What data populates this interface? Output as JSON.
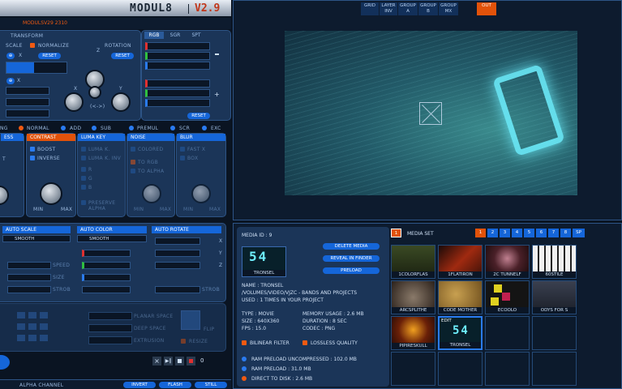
{
  "app": {
    "brand": "MODUL8",
    "version": "V2.9",
    "subtitle": "MODULSV29 2310"
  },
  "transform": {
    "title": "TRANSFORM",
    "scale_label": "SCALE",
    "normalize_label": "NORMALIZE",
    "rotation_label": "ROTATION",
    "x_label": "X",
    "y_label": "Y",
    "z_label": "Z",
    "reset_label": "RESET",
    "dir_label": "(<->)"
  },
  "color_tabs": [
    "RGB",
    "SGR",
    "SPT"
  ],
  "color_reset": "RESET",
  "blend_modes": [
    "NG",
    "NORMAL",
    "ADD",
    "SUB"
  ],
  "blend_modes2": [
    "PREMUL",
    "SCR",
    "EXC"
  ],
  "fx": {
    "col1": {
      "title": "ESS",
      "items": [
        "T"
      ]
    },
    "contrast": {
      "title": "CONTRAST",
      "items": [
        "BOOST",
        "INVERSE"
      ]
    },
    "lumakey": {
      "title": "LUMA KEY",
      "items": [
        "LUMA K.",
        "LUMA K. INV",
        "R",
        "G",
        "B",
        "PRESERVE ALPHA"
      ]
    },
    "noise": {
      "title": "NOISE",
      "items": [
        "COLORED",
        "TO RGB",
        "TO ALPHA"
      ]
    },
    "blur": {
      "title": "BLUR",
      "items": [
        "FAST X",
        "BOX"
      ]
    },
    "min_label": "MIN",
    "max_label": "MAX"
  },
  "auto": {
    "scale": {
      "title": "AUTO SCALE",
      "mode": "SMOOTH"
    },
    "color": {
      "title": "AUTO COLOR",
      "mode": "SMOOTH"
    },
    "rotate": {
      "title": "AUTO ROTATE"
    },
    "speed_label": "SPEED",
    "size_label": "SIZE",
    "strob_label": "STROB",
    "xyz": [
      "X",
      "Y",
      "Z"
    ]
  },
  "planar": {
    "space1": "PLANAR SPACE",
    "space2": "DEEP SPACE",
    "extrusion": "EXTRUSION",
    "flip": "FLIP",
    "resize": "RESIZE",
    "counter": "0"
  },
  "bottom_bar": {
    "alpha_label": "ALPHA CHANNEL",
    "invert": "INVERT",
    "flash": "FLASH",
    "still": "STILL"
  },
  "preview_tabs": [
    {
      "label": "GRID",
      "active": false
    },
    {
      "label": "LAYER INV",
      "active": false
    },
    {
      "label": "GROUP A",
      "active": false
    },
    {
      "label": "GROUP B",
      "active": false
    },
    {
      "label": "GROUP MX",
      "active": false
    },
    {
      "label": "OUT",
      "active": true
    }
  ],
  "media": {
    "media_id": "MEDIA ID : 9",
    "preview_name": "TRONSEL",
    "delete": "DELETE MEDIA",
    "reveal": "REVEAL IN FINDER",
    "preload": "PRELOAD",
    "name": "NAME : TRONSEL",
    "path": "/VOLUMES/VIDEO/VJZC - BANDS AND PROJECTS",
    "used": "USED : 1 TIMES IN YOUR PROJECT",
    "type": "TYPE : MOVIE",
    "size": "SIZE : 640X360",
    "fps": "FPS : 15.0",
    "memory": "MEMORY USAGE : 2.6 MB",
    "duration": "DURATION : 8 SEC",
    "codec": "CODEC : PNG",
    "bilinear": "BILINEAR FILTER",
    "lossless": "LOSSLESS QUALITY",
    "ram_uncomp": "RAM PRELOAD UNCOMPRESSED : 102.0 MB",
    "ram_preload": "RAM PRELOAD : 31.0 MB",
    "direct": "DIRECT TO DISK : 2.6 MB"
  },
  "media_set": {
    "label": "MEDIA SET",
    "numbers": [
      "1",
      "2",
      "3",
      "4",
      "5",
      "6",
      "7",
      "8",
      "SP"
    ],
    "active": "1",
    "side_number": "1"
  },
  "thumbs": [
    {
      "label": "1COLORFLAS",
      "color": "#3a4a24"
    },
    {
      "label": "1FLATIRON",
      "color": "#5a1a10"
    },
    {
      "label": "2C TUNNELF",
      "color": "#2a1418"
    },
    {
      "label": "60STILE",
      "color": "#dcdcdc"
    },
    {
      "label": "ARCSPLITHE",
      "color": "#4a3a2a"
    },
    {
      "label": "CODE MOTHER",
      "color": "#7a5a2a"
    },
    {
      "label": "ECOOLO",
      "color": "#141414"
    },
    {
      "label": "ODYS FOR S",
      "color": "#2a3040"
    },
    {
      "label": "PIPIRESKULL",
      "color": "#3a1a08"
    },
    {
      "label": "TRONSEL",
      "color": "#08202a",
      "edit": "EDIT",
      "selected": true
    }
  ],
  "colors": {
    "accent": "#1566d9",
    "orange": "#e2520a",
    "panel": "#1b3558"
  }
}
